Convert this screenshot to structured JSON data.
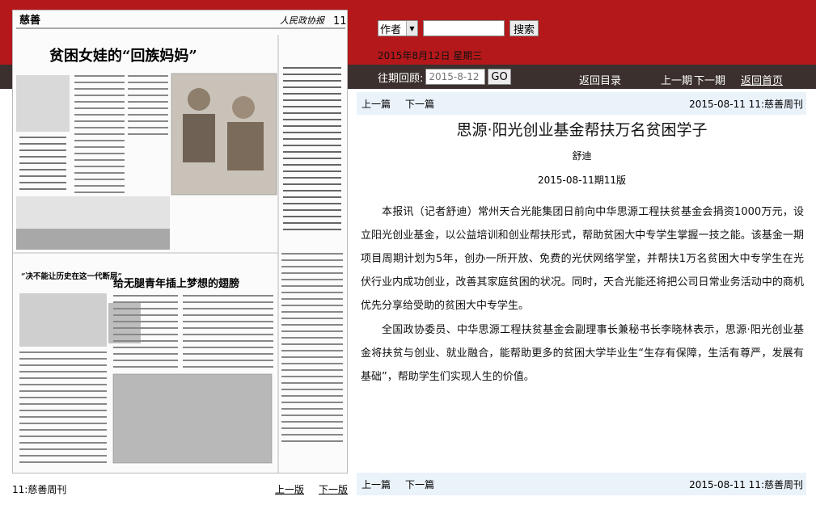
{
  "search": {
    "field_selected": "作者",
    "query": "",
    "button_label": "搜索"
  },
  "header": {
    "date": "2015年8月12日 星期三"
  },
  "archive": {
    "label": "往期回顾:",
    "date_placeholder": "2015-8-12",
    "go_label": "GO"
  },
  "nav": {
    "back_to_index": "返回目录",
    "prev_issue": "上一期",
    "next_issue": "下一期",
    "home": "返回首页"
  },
  "article_nav": {
    "prev": "上一篇",
    "next": "下一篇",
    "meta": "2015-08-11 11:慈善周刊"
  },
  "article": {
    "title": "思源·阳光创业基金帮扶万名贫困学子",
    "author": "舒迪",
    "issue": "2015-08-11期11版",
    "paragraphs": [
      "本报讯（记者舒迪）常州天合光能集团日前向中华思源工程扶贫基金会捐资1000万元，设立阳光创业基金，以公益培训和创业帮扶形式，帮助贫困大中专学生掌握一技之能。该基金一期项目周期计划为5年，创办一所开放、免费的光伏网络学堂，并帮扶1万名贫困大中专学生在光伏行业内成功创业，改善其家庭贫困的状况。同时，天合光能还将把公司日常业务活动中的商机优先分享给受助的贫困大中专学生。",
      "全国政协委员、中华思源工程扶贫基金会副理事长兼秘书长李晓林表示，思源·阳光创业基金将扶贫与创业、就业融合，能帮助更多的贫困大学毕业生“生存有保障，生活有尊严，发展有基础”，帮助学生们实现人生的价值。"
    ]
  },
  "page": {
    "label": "11:慈善周刊",
    "prev_page": "上一版",
    "next_page": "下一版",
    "headline_main": "贫困女娃的“回族妈妈”",
    "headline_second": "给无腿青年插上梦想的翅膀",
    "headline_left": "“决不能让历史在这一代断层”",
    "masthead_section": "慈善",
    "masthead_right": "人民政协报",
    "page_no": "11"
  }
}
